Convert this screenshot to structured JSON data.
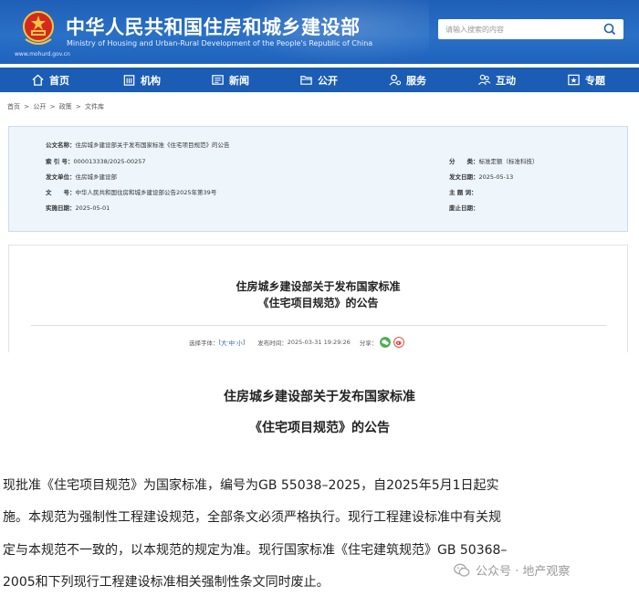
{
  "header": {
    "site_title": "中华人民共和国住房和城乡建设部",
    "site_subtitle": "Ministry of Housing and Urban-Rural Development of the People's Republic of China",
    "site_domain": "www.mohurd.gov.cn",
    "search_placeholder": "请输入搜索的内容",
    "brand_color": "#1f5fb7"
  },
  "nav": {
    "items": [
      {
        "label": "首页",
        "icon": "home-icon"
      },
      {
        "label": "机构",
        "icon": "building-icon"
      },
      {
        "label": "新闻",
        "icon": "news-icon"
      },
      {
        "label": "公开",
        "icon": "folder-icon"
      },
      {
        "label": "服务",
        "icon": "user-service-icon"
      },
      {
        "label": "互动",
        "icon": "interaction-icon"
      },
      {
        "label": "专题",
        "icon": "topic-icon"
      }
    ],
    "active_index": 3
  },
  "breadcrumb": [
    "首页",
    ">",
    "公开",
    ">",
    "政策",
    ">",
    "文件库"
  ],
  "meta": {
    "title_label": "公文名称：",
    "title_value": "住房城乡建设部关于发布国家标准《住宅项目规范》的公告",
    "index_label": "索 引 号：",
    "index_value": "000013338/2025-00257",
    "category_label": "分　　类：",
    "category_value": "标准定额（标准科技）",
    "issuer_label": "发文单位：",
    "issuer_value": "住房城乡建设部",
    "date_label": "发文日期：",
    "date_value": "2025-05-13",
    "doc_no_label": "文　　号：",
    "doc_no_value": "中华人民共和国住房和城乡建设部公告2025年第39号",
    "subject_label": "主 题 词：",
    "subject_value": "",
    "effective_label": "实施日期：",
    "effective_value": "2025-05-01",
    "repeal_label": "废止日期：",
    "repeal_value": ""
  },
  "card": {
    "title_line1": "住房城乡建设部关于发布国家标准",
    "title_line2": "《住宅项目规范》的公告",
    "font_label": "选择字体：",
    "font_open": "[",
    "font_large": "大",
    "font_medium": "中",
    "font_small": "小",
    "font_close": "]",
    "dot": "·",
    "publish_label": "发布时间：",
    "publish_value": "2025-03-31 19:29:26",
    "share_label": "分享："
  },
  "body": {
    "title_line1": "住房城乡建设部关于发布国家标准",
    "title_line2": "《住宅项目规范》的公告",
    "lines": [
      "现批准《住宅项目规范》为国家标准，编号为GB 55038–2025，自2025年5月1日起实",
      "施。本规范为强制性工程建设规范，全部条文必须严格执行。现行工程建设标准中有关规",
      "定与本规范不一致的，以本规范的规定为准。现行国家标准《住宅建筑规范》GB 50368–",
      "2005和下列现行工程建设标准相关强制性条文同时废止。"
    ]
  },
  "watermark": {
    "text": "公众号 · 地产观察",
    "icon": "wechat-icon"
  }
}
